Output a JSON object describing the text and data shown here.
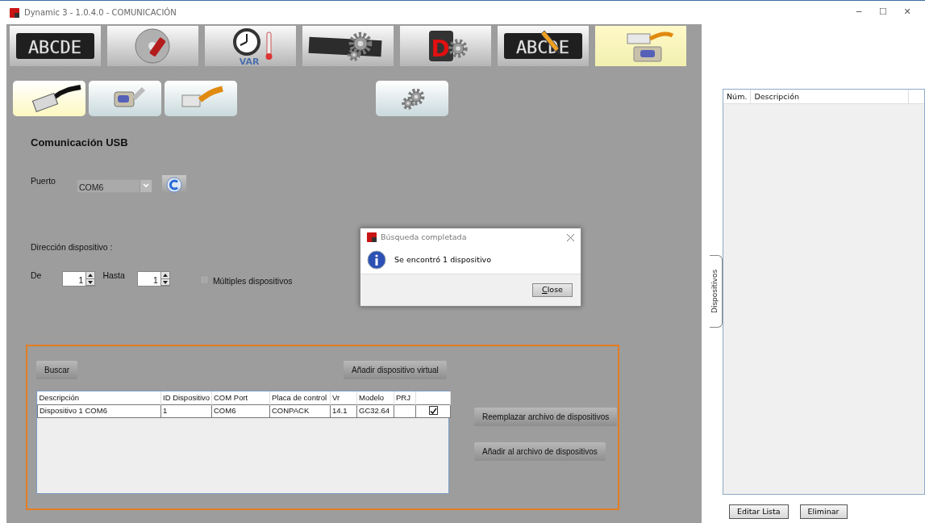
{
  "window": {
    "title": "Dynamic 3 - 1.0.4.0 - COMUNICACIÓN",
    "controls": [
      "─",
      "☐",
      "✕"
    ]
  },
  "toolbar": [
    {
      "kind": "led",
      "label": "ABCDE",
      "selected": false
    },
    {
      "kind": "disc",
      "selected": false
    },
    {
      "kind": "clock",
      "label": "VAR",
      "selected": false
    },
    {
      "kind": "panel-gear",
      "selected": false
    },
    {
      "kind": "logo",
      "label": "D",
      "selected": false
    },
    {
      "kind": "led-edit",
      "label": "ABCDE",
      "selected": false
    },
    {
      "kind": "connector",
      "selected": true
    }
  ],
  "subtabs": [
    {
      "kind": "usb",
      "selected": true
    },
    {
      "kind": "serial",
      "selected": false
    },
    {
      "kind": "ethernet",
      "selected": false
    },
    {
      "kind": "settings",
      "selected": false
    }
  ],
  "section_title": "Comunicación USB",
  "port": {
    "label": "Puerto",
    "value": "COM6"
  },
  "address": {
    "label": "Dirección dispositivo :",
    "from_label": "De",
    "from_value": "1",
    "to_label": "Hasta",
    "to_value": "1",
    "multiple": {
      "label": "Múltiples dispositivos",
      "checked": false
    }
  },
  "search_button": "Buscar",
  "virtual_button": "Añadir dispositivo virtual",
  "devices_table": {
    "columns": [
      "Descripción",
      "ID Dispositivo",
      "COM Port",
      "Placa de control",
      "Vr",
      "Modelo",
      "PRJ"
    ],
    "rows": [
      {
        "cells": [
          "Dispositivo 1 COM6",
          "1",
          "COM6",
          "CONPACK",
          "14.1",
          "GC32.64",
          ""
        ],
        "checked": true
      }
    ]
  },
  "file_buttons": [
    "Reemplazar archivo de dispositivos",
    "Añadir al archivo de dispositivos"
  ],
  "dialog": {
    "title": "Búsqueda completada",
    "message": "Se encontró 1 dispositivo",
    "button": "Close"
  },
  "side_panel": {
    "tab": "Dispositivos",
    "columns": [
      "Núm.",
      "Descripción"
    ],
    "buttons": [
      "Editar Lista",
      "Eliminar"
    ]
  }
}
